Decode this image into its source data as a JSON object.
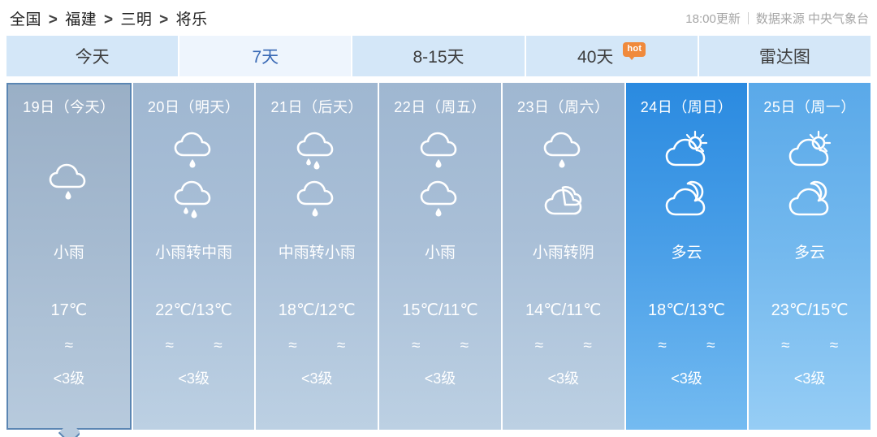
{
  "header": {
    "breadcrumb": [
      "全国",
      "福建",
      "三明",
      "将乐"
    ],
    "breadcrumb_separator": ">",
    "update_time": "18:00更新",
    "source": "数据来源 中央气象台"
  },
  "tabs": [
    {
      "label": "今天",
      "active": false,
      "badge": null
    },
    {
      "label": "7天",
      "active": true,
      "badge": null
    },
    {
      "label": "8-15天",
      "active": false,
      "badge": null
    },
    {
      "label": "40天",
      "active": false,
      "badge": "hot"
    },
    {
      "label": "雷达图",
      "active": false,
      "badge": null
    }
  ],
  "forecast": [
    {
      "date": "19日（今天）",
      "icons": [
        "rain-light"
      ],
      "condition": "小雨",
      "temperature": "17℃",
      "wind_icons": "≈",
      "wind_level": "<3级",
      "style": "today"
    },
    {
      "date": "20日（明天）",
      "icons": [
        "rain-light",
        "rain-moderate"
      ],
      "condition": "小雨转中雨",
      "temperature": "22℃/13℃",
      "wind_icons": "≈ ≈",
      "wind_level": "<3级",
      "style": "normal"
    },
    {
      "date": "21日（后天）",
      "icons": [
        "rain-moderate",
        "rain-light"
      ],
      "condition": "中雨转小雨",
      "temperature": "18℃/12℃",
      "wind_icons": "≈ ≈",
      "wind_level": "<3级",
      "style": "normal"
    },
    {
      "date": "22日（周五）",
      "icons": [
        "rain-light",
        "rain-light"
      ],
      "condition": "小雨",
      "temperature": "15℃/11℃",
      "wind_icons": "≈ ≈",
      "wind_level": "<3级",
      "style": "normal"
    },
    {
      "date": "23日（周六）",
      "icons": [
        "rain-light",
        "overcast"
      ],
      "condition": "小雨转阴",
      "temperature": "14℃/11℃",
      "wind_icons": "≈ ≈",
      "wind_level": "<3级",
      "style": "normal"
    },
    {
      "date": "24日（周日）",
      "icons": [
        "partly-cloudy-day",
        "partly-cloudy-night"
      ],
      "condition": "多云",
      "temperature": "18℃/13℃",
      "wind_icons": "≈ ≈",
      "wind_level": "<3级",
      "style": "highlight"
    },
    {
      "date": "25日（周一）",
      "icons": [
        "partly-cloudy-day",
        "partly-cloudy-night"
      ],
      "condition": "多云",
      "temperature": "23℃/15℃",
      "wind_icons": "≈ ≈",
      "wind_level": "<3级",
      "style": "light"
    }
  ],
  "colors": {
    "tab_inactive_bg": "#d4e7f8",
    "tab_active_bg": "#eef5fd",
    "tab_active_text": "#3a6ab5",
    "badge_bg": "#f08a3c",
    "today_border": "#5b86b3",
    "highlight_card_top": "#2a8ae0",
    "light_card_top": "#5aa9e9"
  }
}
